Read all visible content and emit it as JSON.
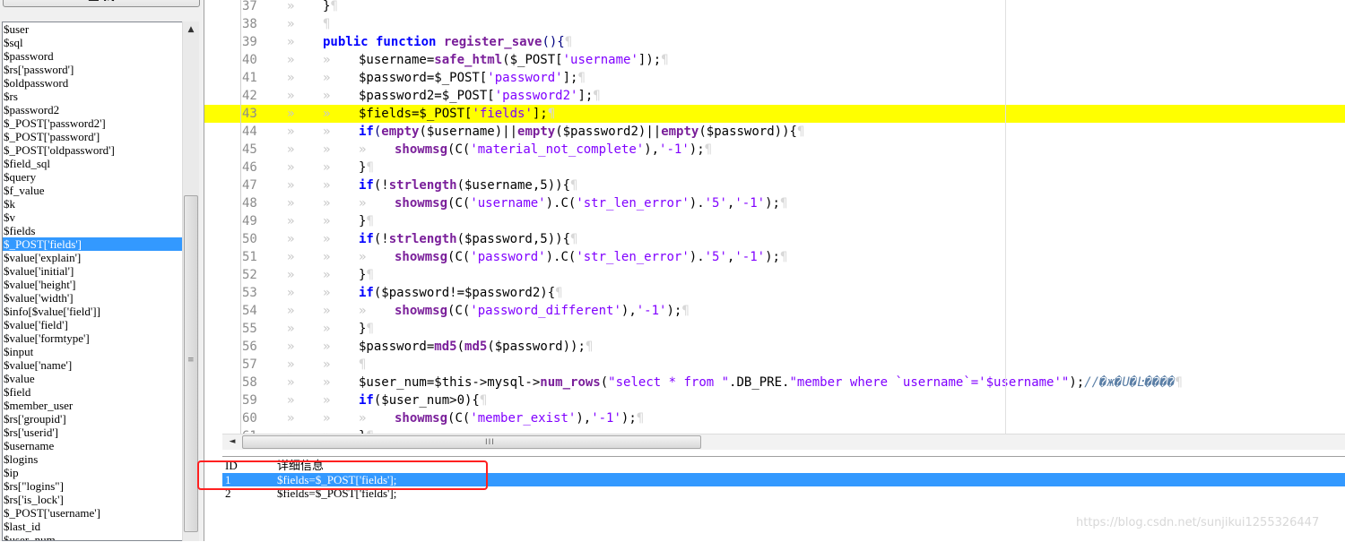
{
  "left_panel": {
    "search_button": "查  找",
    "variables": [
      "$user",
      "$sql",
      "$password",
      "$rs['password']",
      "$oldpassword",
      "$rs",
      "$password2",
      "$_POST['password2']",
      "$_POST['password']",
      "$_POST['oldpassword']",
      "$field_sql",
      "$query",
      "$f_value",
      "$k",
      "$v",
      "$fields",
      "$_POST['fields']",
      "$value['explain']",
      "$value['initial']",
      "$value['height']",
      "$value['width']",
      "$info[$value['field']]",
      "$value['field']",
      "$value['formtype']",
      "$input",
      "$value['name']",
      "$value",
      "$field",
      "$member_user",
      "$rs['groupid']",
      "$rs['userid']",
      "$username",
      "$logins",
      "$ip",
      "$rs[\"logins\"]",
      "$rs['is_lock']",
      "$_POST['username']",
      "$last_id",
      "$user_num"
    ],
    "selected_variable": "$_POST['fields']"
  },
  "editor": {
    "tab_glyph": "»",
    "pilcrow": "¶",
    "highlighted_line": "43",
    "lines": [
      {
        "n": "37",
        "indent": 1,
        "tokens": [
          {
            "t": "}",
            "c": "plain"
          }
        ]
      },
      {
        "n": "38",
        "indent": 1,
        "tokens": []
      },
      {
        "n": "39",
        "indent": 1,
        "tokens": [
          {
            "t": "public function ",
            "c": "kw"
          },
          {
            "t": "register_save",
            "c": "fn"
          },
          {
            "t": "(){",
            "c": "sym"
          }
        ]
      },
      {
        "n": "40",
        "indent": 2,
        "tokens": [
          {
            "t": "$username=",
            "c": "plain"
          },
          {
            "t": "safe_html",
            "c": "fn"
          },
          {
            "t": "($_POST[",
            "c": "plain"
          },
          {
            "t": "'username'",
            "c": "str"
          },
          {
            "t": "]);",
            "c": "plain"
          }
        ]
      },
      {
        "n": "41",
        "indent": 2,
        "tokens": [
          {
            "t": "$password=$_POST[",
            "c": "plain"
          },
          {
            "t": "'password'",
            "c": "str"
          },
          {
            "t": "];",
            "c": "plain"
          }
        ]
      },
      {
        "n": "42",
        "indent": 2,
        "tokens": [
          {
            "t": "$password2=$_POST[",
            "c": "plain"
          },
          {
            "t": "'password2'",
            "c": "str"
          },
          {
            "t": "];",
            "c": "plain"
          }
        ]
      },
      {
        "n": "43",
        "indent": 2,
        "tokens": [
          {
            "t": "$fields=$_POST[",
            "c": "plain"
          },
          {
            "t": "'fields'",
            "c": "str"
          },
          {
            "t": "];",
            "c": "plain"
          }
        ]
      },
      {
        "n": "44",
        "indent": 2,
        "tokens": [
          {
            "t": "if",
            "c": "kw"
          },
          {
            "t": "(",
            "c": "sym"
          },
          {
            "t": "empty",
            "c": "fn"
          },
          {
            "t": "($username)||",
            "c": "plain"
          },
          {
            "t": "empty",
            "c": "fn"
          },
          {
            "t": "($password2)||",
            "c": "plain"
          },
          {
            "t": "empty",
            "c": "fn"
          },
          {
            "t": "($password)){",
            "c": "plain"
          }
        ]
      },
      {
        "n": "45",
        "indent": 3,
        "tokens": [
          {
            "t": "showmsg",
            "c": "fn"
          },
          {
            "t": "(C(",
            "c": "plain"
          },
          {
            "t": "'material_not_complete'",
            "c": "str"
          },
          {
            "t": "),",
            "c": "plain"
          },
          {
            "t": "'-1'",
            "c": "str"
          },
          {
            "t": ");",
            "c": "plain"
          }
        ]
      },
      {
        "n": "46",
        "indent": 2,
        "tokens": [
          {
            "t": "}",
            "c": "plain"
          }
        ]
      },
      {
        "n": "47",
        "indent": 2,
        "tokens": [
          {
            "t": "if",
            "c": "kw"
          },
          {
            "t": "(!",
            "c": "plain"
          },
          {
            "t": "strlength",
            "c": "fn"
          },
          {
            "t": "($username,5)){",
            "c": "plain"
          }
        ]
      },
      {
        "n": "48",
        "indent": 3,
        "tokens": [
          {
            "t": "showmsg",
            "c": "fn"
          },
          {
            "t": "(C(",
            "c": "plain"
          },
          {
            "t": "'username'",
            "c": "str"
          },
          {
            "t": ").C(",
            "c": "plain"
          },
          {
            "t": "'str_len_error'",
            "c": "str"
          },
          {
            "t": ").",
            "c": "plain"
          },
          {
            "t": "'5'",
            "c": "str"
          },
          {
            "t": ",",
            "c": "plain"
          },
          {
            "t": "'-1'",
            "c": "str"
          },
          {
            "t": ");",
            "c": "plain"
          }
        ]
      },
      {
        "n": "49",
        "indent": 2,
        "tokens": [
          {
            "t": "}",
            "c": "plain"
          }
        ]
      },
      {
        "n": "50",
        "indent": 2,
        "tokens": [
          {
            "t": "if",
            "c": "kw"
          },
          {
            "t": "(!",
            "c": "plain"
          },
          {
            "t": "strlength",
            "c": "fn"
          },
          {
            "t": "($password,5)){",
            "c": "plain"
          }
        ]
      },
      {
        "n": "51",
        "indent": 3,
        "tokens": [
          {
            "t": "showmsg",
            "c": "fn"
          },
          {
            "t": "(C(",
            "c": "plain"
          },
          {
            "t": "'password'",
            "c": "str"
          },
          {
            "t": ").C(",
            "c": "plain"
          },
          {
            "t": "'str_len_error'",
            "c": "str"
          },
          {
            "t": ").",
            "c": "plain"
          },
          {
            "t": "'5'",
            "c": "str"
          },
          {
            "t": ",",
            "c": "plain"
          },
          {
            "t": "'-1'",
            "c": "str"
          },
          {
            "t": ");",
            "c": "plain"
          }
        ]
      },
      {
        "n": "52",
        "indent": 2,
        "tokens": [
          {
            "t": "}",
            "c": "plain"
          }
        ]
      },
      {
        "n": "53",
        "indent": 2,
        "tokens": [
          {
            "t": "if",
            "c": "kw"
          },
          {
            "t": "($password!=$password2){",
            "c": "plain"
          }
        ]
      },
      {
        "n": "54",
        "indent": 3,
        "tokens": [
          {
            "t": "showmsg",
            "c": "fn"
          },
          {
            "t": "(C(",
            "c": "plain"
          },
          {
            "t": "'password_different'",
            "c": "str"
          },
          {
            "t": "),",
            "c": "plain"
          },
          {
            "t": "'-1'",
            "c": "str"
          },
          {
            "t": ");",
            "c": "plain"
          }
        ]
      },
      {
        "n": "55",
        "indent": 2,
        "tokens": [
          {
            "t": "}",
            "c": "plain"
          }
        ]
      },
      {
        "n": "56",
        "indent": 2,
        "tokens": [
          {
            "t": "$password=",
            "c": "plain"
          },
          {
            "t": "md5",
            "c": "fn"
          },
          {
            "t": "(",
            "c": "plain"
          },
          {
            "t": "md5",
            "c": "fn"
          },
          {
            "t": "($password));",
            "c": "plain"
          }
        ]
      },
      {
        "n": "57",
        "indent": 2,
        "tokens": []
      },
      {
        "n": "58",
        "indent": 2,
        "tokens": [
          {
            "t": "$user_num=$this->mysql->",
            "c": "plain"
          },
          {
            "t": "num_rows",
            "c": "fn"
          },
          {
            "t": "(",
            "c": "plain"
          },
          {
            "t": "\"select * from \"",
            "c": "str"
          },
          {
            "t": ".DB_PRE.",
            "c": "plain"
          },
          {
            "t": "\"member where `username`='$username'\"",
            "c": "str"
          },
          {
            "t": ");",
            "c": "plain"
          },
          {
            "t": "//�ж�U�Ŀ����",
            "c": "cmt"
          }
        ]
      },
      {
        "n": "59",
        "indent": 2,
        "tokens": [
          {
            "t": "if",
            "c": "kw"
          },
          {
            "t": "($user_num>0){",
            "c": "plain"
          }
        ]
      },
      {
        "n": "60",
        "indent": 3,
        "tokens": [
          {
            "t": "showmsg",
            "c": "fn"
          },
          {
            "t": "(C(",
            "c": "plain"
          },
          {
            "t": "'member_exist'",
            "c": "str"
          },
          {
            "t": "),",
            "c": "plain"
          },
          {
            "t": "'-1'",
            "c": "str"
          },
          {
            "t": ");",
            "c": "plain"
          }
        ]
      },
      {
        "n": "61",
        "indent": 2,
        "tokens": [
          {
            "t": "}",
            "c": "plain"
          }
        ]
      }
    ]
  },
  "hscroll": {
    "grip": "III"
  },
  "results": {
    "header": {
      "id": "ID",
      "info": "详细信息"
    },
    "rows": [
      {
        "id": "1",
        "info": "$fields=$_POST['fields'];"
      },
      {
        "id": "2",
        "info": "$fields=$_POST['fields'];"
      }
    ],
    "selected_row": "1"
  },
  "watermark": "https://blog.csdn.net/sunjikui1255326447",
  "colors": {
    "highlight": "#ffff00",
    "selection": "#3399ff",
    "keyword": "#0000ff",
    "string": "#8000ff",
    "annotation": "#ff2020"
  }
}
